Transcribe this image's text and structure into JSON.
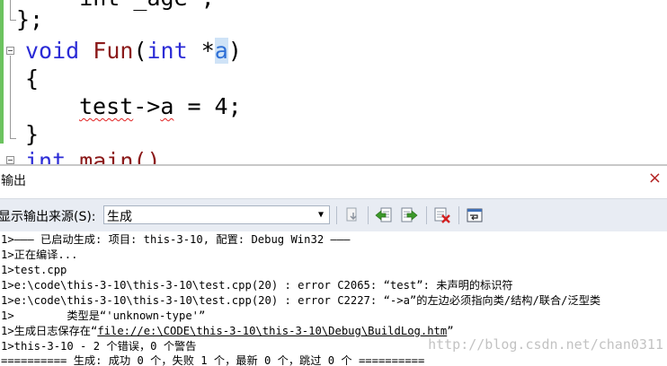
{
  "editor": {
    "lines": {
      "l0": "    int _age ;",
      "l1_brace": "};",
      "l2_kw": "void",
      "l2_fn": "Fun",
      "l2_open": "(",
      "l2_type": "int",
      "l2_star": " *",
      "l2_param": "a",
      "l2_close": ")",
      "l3": "{",
      "l4_obj": "test",
      "l4_arrow": "->",
      "l4_member": "a",
      "l4_rest": " = 4;",
      "l5": "}",
      "l6_kw": "int",
      "l6_fn": " main()"
    }
  },
  "output": {
    "title": "输出",
    "close_glyph": "×",
    "source_label": "显示输出来源(S):",
    "source_value": "生成",
    "lines": [
      "1>——— 已启动生成: 项目: this-3-10, 配置: Debug Win32 ———",
      "1>正在编译...",
      "1>test.cpp",
      "1>e:\\code\\this-3-10\\this-3-10\\test.cpp(20) : error C2065: “test”: 未声明的标识符",
      "1>e:\\code\\this-3-10\\this-3-10\\test.cpp(20) : error C2227: “->a”的左边必须指向类/结构/联合/泛型类",
      "1>        类型是“'unknown-type'”"
    ],
    "buildlog_prefix": "1>生成日志保存在“",
    "buildlog_link": "file://e:\\CODE\\this-3-10\\this-3-10\\Debug\\BuildLog.htm",
    "buildlog_suffix": "”",
    "summary": "1>this-3-10 - 2 个错误，0 个警告",
    "final": "========== 生成: 成功 0 个，失败 1 个，最新 0 个，跳过 0 个 ==========",
    "watermark": "http://blog.csdn.net/chan0311"
  }
}
